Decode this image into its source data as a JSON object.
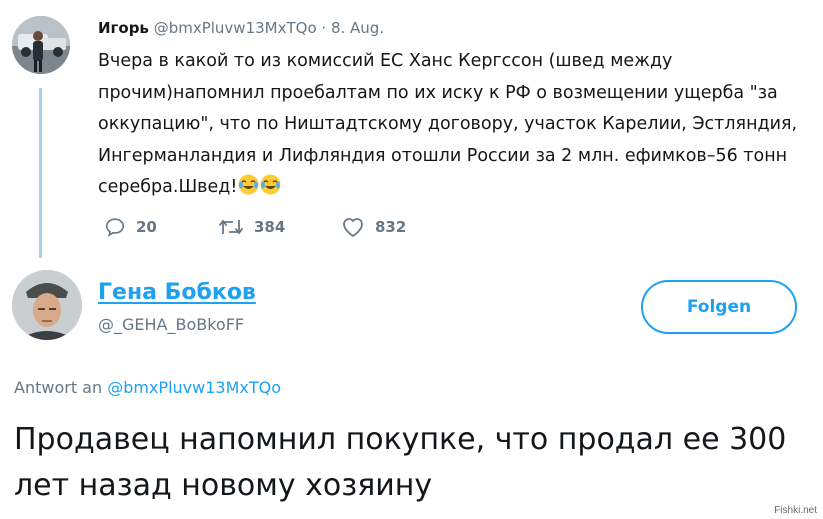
{
  "tweet": {
    "author_name": "Игорь",
    "author_handle": "@bmxPluvw13MxTQo",
    "date": "· 8. Aug.",
    "text": "Вчера в какой то из комиссий ЕС Ханс Кергссон (швед между прочим)напомнил проебалтам по их иску к РФ о возмещении ущерба \"за оккупацию\", что по Ништадтскому договору, участок Карелии, Эстляндия, Ингерманландия и Лифляндия отошли России за 2 млн. ефимков–56 тонн серебра.Швед!",
    "emojis": [
      "joy-emoji",
      "joy-emoji"
    ],
    "actions": {
      "replies": "20",
      "retweets": "384",
      "likes": "832"
    }
  },
  "reply": {
    "author_name": "Гена Бобков",
    "author_handle": "@_GEHA_BoBkoFF",
    "follow_label": "Folgen",
    "reply_to_prefix": "Antwort an",
    "reply_to_handle": "@bmxPluvw13MxTQo",
    "text": "Продавец напомнил покупке, что продал ее 300 лет назад новому хозяину"
  },
  "watermark": "Fishki.net",
  "colors": {
    "accent": "#1da1f2",
    "thread_line": "#a3d2f0",
    "muted": "#657786",
    "text": "#14171a"
  }
}
